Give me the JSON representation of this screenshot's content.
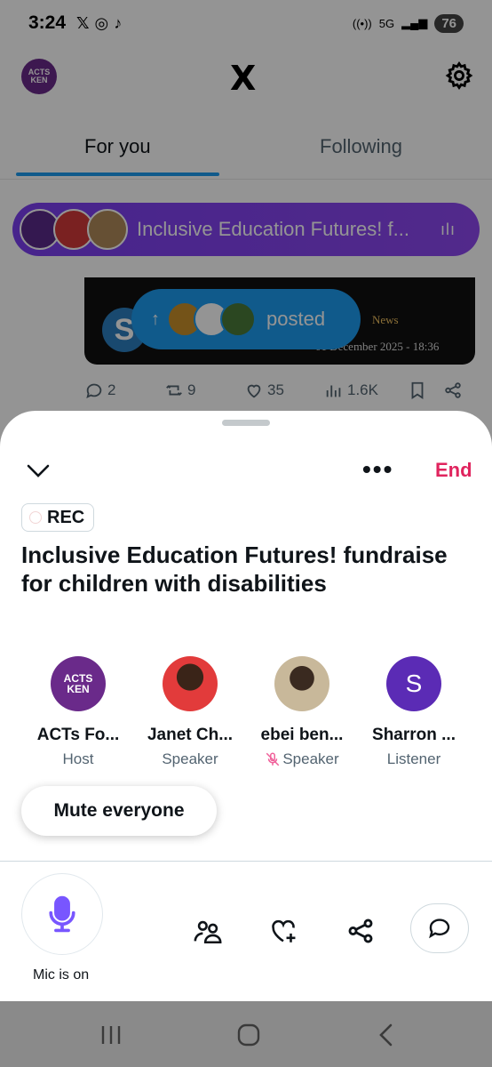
{
  "status_bar": {
    "time": "3:24",
    "apps": [
      "X",
      "WhatsApp",
      "TikTok"
    ],
    "network": "5G",
    "battery": "76"
  },
  "timeline": {
    "brand": "X",
    "tabs": [
      {
        "label": "For you",
        "active": true
      },
      {
        "label": "Following",
        "active": false
      }
    ],
    "space_pill": {
      "title": "Inclusive Education Futures! f..."
    },
    "posted_pill": {
      "label": "posted"
    },
    "tweet_card": {
      "news_label": "News",
      "date": "01 December 2025 - 18:36"
    },
    "tweet_actions": {
      "replies": "2",
      "reposts": "9",
      "likes": "35",
      "views": "1.6K"
    }
  },
  "space": {
    "end_label": "End",
    "rec_label": "REC",
    "title": "Inclusive Education Futures! fundraise for children with disabilities",
    "participants": [
      {
        "name": "ACTs Fo...",
        "role": "Host",
        "avatar": "org-logo",
        "muted": false
      },
      {
        "name": "Janet Ch...",
        "role": "Speaker",
        "avatar": "photo",
        "muted": false
      },
      {
        "name": "ebei ben...",
        "role": "Speaker",
        "avatar": "photo",
        "muted": true
      },
      {
        "name": "Sharron ...",
        "role": "Listener",
        "avatar": "initial",
        "initial": "S",
        "muted": false
      }
    ],
    "mute_all_label": "Mute everyone",
    "mic_label": "Mic is on"
  },
  "colors": {
    "accent": "#1d9bf0",
    "space_purple": "#7b3ff2",
    "end_red": "#e0245e",
    "mic_purple": "#7856ff"
  }
}
